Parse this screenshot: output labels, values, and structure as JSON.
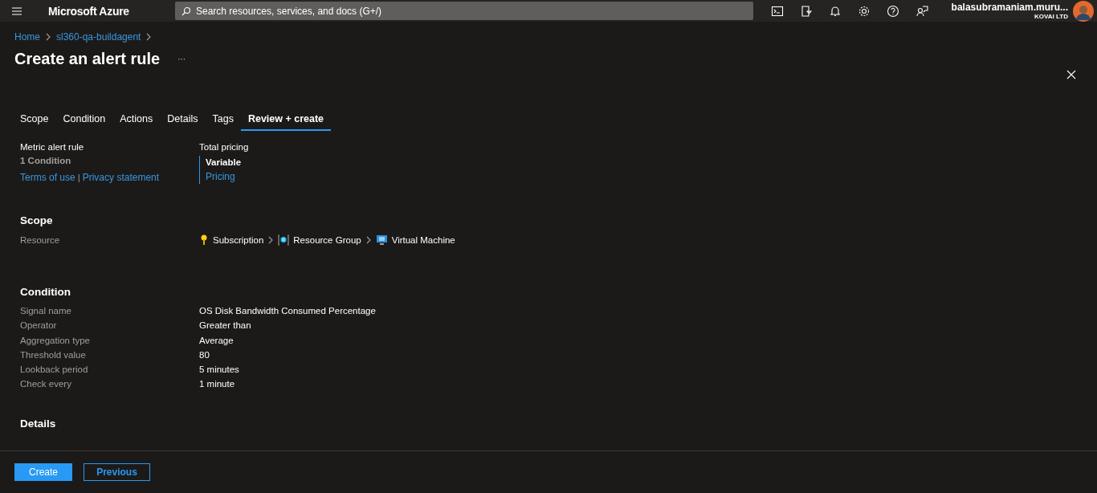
{
  "topbar": {
    "brand": "Microsoft Azure",
    "search": {
      "placeholder": "Search resources, services, and docs (G+/)"
    },
    "user": {
      "name": "balasubramaniam.muru...",
      "org": "KOVAI LTD"
    }
  },
  "breadcrumb": [
    "Home",
    "sl360-qa-buildagent"
  ],
  "title": "Create an alert rule",
  "more": "···",
  "tabs": [
    {
      "label": "Scope",
      "selected": false
    },
    {
      "label": "Condition",
      "selected": false
    },
    {
      "label": "Actions",
      "selected": false
    },
    {
      "label": "Details",
      "selected": false
    },
    {
      "label": "Tags",
      "selected": false
    },
    {
      "label": "Review + create",
      "selected": true
    }
  ],
  "summary": {
    "rule_type": "Metric alert rule",
    "conditions": "1 Condition",
    "terms_link": "Terms of use",
    "separator": "|",
    "privacy_link": "Privacy statement",
    "pricing_label": "Total pricing",
    "pricing_value": "Variable",
    "pricing_link": "Pricing"
  },
  "scope": {
    "heading": "Scope",
    "label": "Resource",
    "path": [
      "Subscription",
      "Resource Group",
      "Virtual Machine"
    ]
  },
  "condition": {
    "heading": "Condition",
    "rows": [
      {
        "label": "Signal name",
        "value": "OS Disk Bandwidth Consumed Percentage"
      },
      {
        "label": "Operator",
        "value": "Greater than"
      },
      {
        "label": "Aggregation type",
        "value": "Average"
      },
      {
        "label": "Threshold value",
        "value": "80"
      },
      {
        "label": "Lookback period",
        "value": "5 minutes"
      },
      {
        "label": "Check every",
        "value": "1 minute"
      }
    ]
  },
  "details_heading": "Details",
  "footer": {
    "create": "Create",
    "previous": "Previous"
  }
}
